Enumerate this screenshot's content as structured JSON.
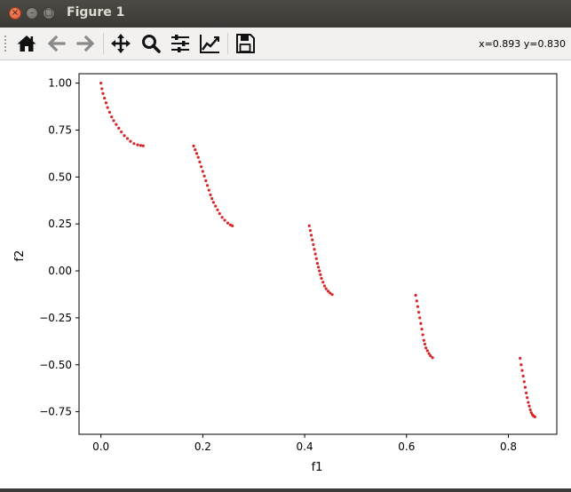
{
  "window": {
    "title": "Figure 1"
  },
  "window_controls": {
    "close_glyph": "×",
    "minimize_glyph": "–",
    "maximize_glyph": "□"
  },
  "toolbar": {
    "icons": [
      "home-icon",
      "back-arrow-icon",
      "forward-arrow-icon",
      "move-icon",
      "zoom-icon",
      "configure-subplots-icon",
      "edit-axes-icon",
      "save-icon"
    ],
    "coordinates": "x=0.893 y=0.830"
  },
  "colors": {
    "points": "#d62728",
    "titlebar": "#3f3e3a",
    "toolbar": "#f2f1f0"
  },
  "chart_data": {
    "type": "scatter",
    "title": "",
    "xlabel": "f1",
    "ylabel": "f2",
    "xlim": [
      -0.043,
      0.895
    ],
    "ylim": [
      -0.87,
      1.05
    ],
    "xticks": [
      0.0,
      0.2,
      0.4,
      0.6,
      0.8
    ],
    "xtick_labels": [
      "0.0",
      "0.2",
      "0.4",
      "0.6",
      "0.8"
    ],
    "yticks": [
      1.0,
      0.75,
      0.5,
      0.25,
      0.0,
      -0.25,
      -0.5,
      -0.75
    ],
    "ytick_labels": [
      "1.00",
      "0.75",
      "0.50",
      "0.25",
      "0.00",
      "−0.25",
      "−0.50",
      "−0.75"
    ],
    "grid": false,
    "series": [
      {
        "marker_color": "#d62728",
        "x": [
          0.0,
          0.002,
          0.004,
          0.007,
          0.01,
          0.013,
          0.017,
          0.021,
          0.025,
          0.03,
          0.035,
          0.04,
          0.046,
          0.052,
          0.058,
          0.065,
          0.072,
          0.078,
          0.083,
          0.182,
          0.185,
          0.188,
          0.191,
          0.194,
          0.197,
          0.2,
          0.203,
          0.206,
          0.209,
          0.212,
          0.215,
          0.218,
          0.221,
          0.225,
          0.229,
          0.233,
          0.238,
          0.243,
          0.249,
          0.254,
          0.258,
          0.409,
          0.411,
          0.413,
          0.415,
          0.417,
          0.419,
          0.421,
          0.423,
          0.425,
          0.427,
          0.429,
          0.431,
          0.433,
          0.436,
          0.439,
          0.442,
          0.446,
          0.45,
          0.454,
          0.618,
          0.62,
          0.622,
          0.624,
          0.626,
          0.628,
          0.63,
          0.632,
          0.634,
          0.636,
          0.638,
          0.641,
          0.644,
          0.647,
          0.651,
          0.823,
          0.825,
          0.827,
          0.829,
          0.831,
          0.833,
          0.835,
          0.837,
          0.839,
          0.841,
          0.843,
          0.845,
          0.847,
          0.849,
          0.852
        ],
        "y": [
          1.0,
          0.97,
          0.945,
          0.92,
          0.895,
          0.87,
          0.845,
          0.82,
          0.8,
          0.78,
          0.76,
          0.74,
          0.72,
          0.705,
          0.69,
          0.678,
          0.671,
          0.668,
          0.666,
          0.665,
          0.645,
          0.625,
          0.605,
          0.58,
          0.555,
          0.53,
          0.505,
          0.48,
          0.455,
          0.43,
          0.405,
          0.385,
          0.365,
          0.345,
          0.325,
          0.305,
          0.285,
          0.27,
          0.255,
          0.245,
          0.24,
          0.24,
          0.215,
          0.19,
          0.165,
          0.14,
          0.115,
          0.09,
          0.065,
          0.04,
          0.02,
          0.0,
          -0.02,
          -0.04,
          -0.06,
          -0.08,
          -0.095,
          -0.108,
          -0.118,
          -0.126,
          -0.13,
          -0.16,
          -0.19,
          -0.22,
          -0.25,
          -0.28,
          -0.31,
          -0.34,
          -0.37,
          -0.39,
          -0.41,
          -0.425,
          -0.44,
          -0.452,
          -0.462,
          -0.465,
          -0.5,
          -0.53,
          -0.56,
          -0.59,
          -0.62,
          -0.65,
          -0.675,
          -0.7,
          -0.72,
          -0.74,
          -0.755,
          -0.765,
          -0.772,
          -0.777
        ]
      }
    ]
  }
}
